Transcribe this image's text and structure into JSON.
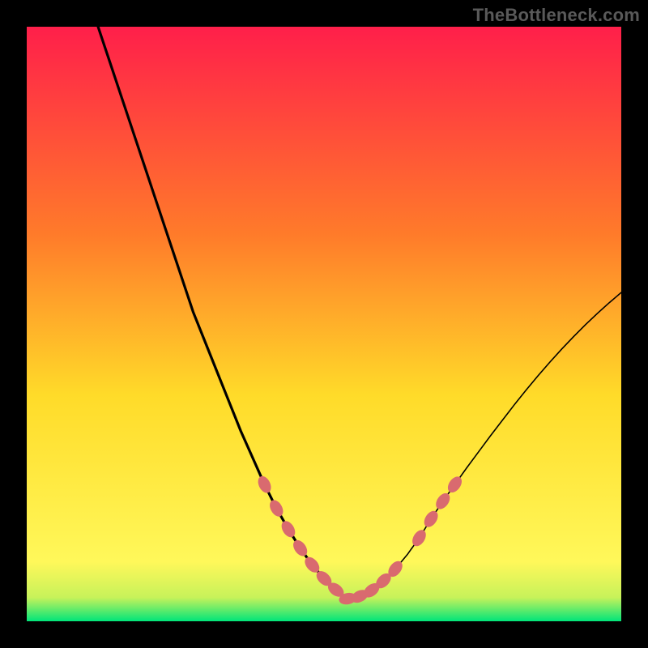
{
  "watermark": "TheBottleneck.com",
  "colors": {
    "top": "#ff1f4a",
    "q1": "#ff7b2a",
    "mid": "#ffdb29",
    "q3": "#fff85a",
    "bottom": "#00e57a",
    "line": "#000000",
    "lineThin": "#000000",
    "dots": "#d96a6f",
    "frame": "#000000"
  },
  "chart_data": {
    "type": "line",
    "title": "",
    "xlabel": "",
    "ylabel": "",
    "xlim": [
      0,
      100
    ],
    "ylim": [
      0,
      100
    ],
    "series": [
      {
        "name": "curve-left-thick",
        "x": [
          12,
          14,
          16,
          18,
          20,
          22,
          24,
          26,
          28,
          30,
          32,
          34,
          36,
          38,
          40,
          42,
          44,
          46,
          48,
          50,
          52,
          54
        ],
        "y": [
          100,
          94,
          88,
          82,
          76,
          70,
          64,
          58,
          52,
          47,
          42,
          37,
          32,
          27.5,
          23,
          19,
          15.5,
          12.3,
          9.5,
          7.2,
          5.3,
          3.8
        ]
      },
      {
        "name": "curve-right-thin",
        "x": [
          54,
          56,
          58,
          60,
          62,
          64,
          66,
          68,
          70,
          72,
          74,
          76,
          78,
          80,
          82,
          84,
          86,
          88,
          90,
          92,
          94,
          96,
          98,
          100
        ],
        "y": [
          3.8,
          4.2,
          5.2,
          6.8,
          8.8,
          11.2,
          14,
          17.2,
          20.2,
          23,
          25.8,
          28.5,
          31.2,
          33.8,
          36.4,
          38.9,
          41.3,
          43.6,
          45.8,
          47.9,
          49.9,
          51.8,
          53.6,
          55.3
        ]
      }
    ],
    "dots": {
      "name": "highlight-points",
      "x": [
        40,
        42,
        44,
        46,
        48,
        50,
        52,
        54,
        56,
        58,
        60,
        62,
        66,
        68,
        70,
        72
      ],
      "y": [
        23,
        19,
        15.5,
        12.3,
        9.5,
        7.2,
        5.3,
        3.8,
        4.2,
        5.2,
        6.8,
        8.8,
        14,
        17.2,
        20.2,
        23
      ]
    },
    "bottom_band_fraction": 0.05
  }
}
